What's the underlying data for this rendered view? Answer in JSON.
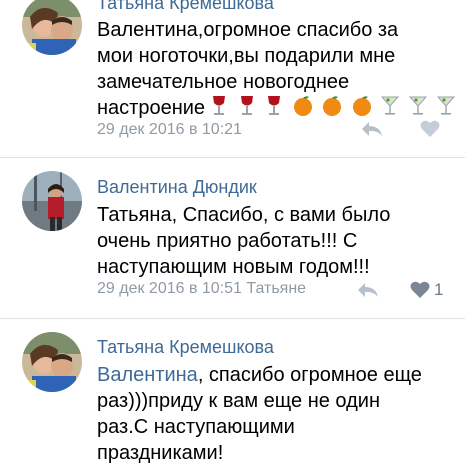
{
  "comments": [
    {
      "author": "Татьяна Кремешкова",
      "lines": [
        "Валентина,огромное спасибо за",
        "мои ноготочки,вы подарили мне",
        "замечательное новогоднее",
        "настроение"
      ],
      "emojis": [
        "wine-glass-icon",
        "wine-glass-icon",
        "wine-glass-icon",
        "orange-icon",
        "orange-icon",
        "orange-icon",
        "cocktail-icon",
        "cocktail-icon",
        "cocktail-icon"
      ],
      "date": "29 дек 2016 в 10:21"
    },
    {
      "author": "Валентина Дюндик",
      "lines": [
        "Татьяна, Спасибо,  с вами было",
        "очень приятно работать!!! С",
        "наступающим новым годом!!!"
      ],
      "date": "29 дек 2016 в 10:51",
      "reply_to": "Татьяне",
      "likes": "1"
    },
    {
      "author": "Татьяна Кремешкова",
      "mention": "Валентина",
      "first_line_rest": ", спасибо огромное еще",
      "lines": [
        "раз)))приду к вам еще не один",
        "раз.С наступающими",
        "праздниками!"
      ]
    }
  ],
  "colors": {
    "link": "#3f6a96",
    "meta": "#909aa6",
    "divider": "#dfe3e8"
  }
}
